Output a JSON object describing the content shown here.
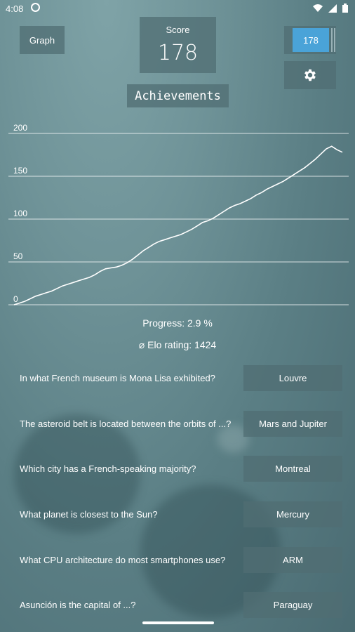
{
  "status": {
    "time": "4:08"
  },
  "header": {
    "graph_label": "Graph",
    "score_label": "Score",
    "score_value": "178",
    "elo_badge": "178",
    "achievements_label": "Achievements"
  },
  "chart_data": {
    "type": "line",
    "ylim": [
      0,
      200
    ],
    "yticks": [
      "200",
      "150",
      "100",
      "50",
      "0"
    ],
    "series": [
      {
        "values": [
          0,
          2,
          4,
          7,
          10,
          12,
          14,
          16,
          19,
          22,
          24,
          26,
          28,
          30,
          32,
          35,
          39,
          42,
          43,
          44,
          46,
          49,
          53,
          58,
          63,
          67,
          71,
          74,
          76,
          78,
          80,
          82,
          85,
          88,
          92,
          96,
          98,
          101,
          105,
          109,
          113,
          116,
          118,
          121,
          124,
          128,
          131,
          135,
          138,
          141,
          144,
          148,
          152,
          156,
          160,
          165,
          170,
          176,
          182,
          185,
          181,
          178
        ]
      }
    ]
  },
  "stats": {
    "progress": "Progress:  2.9 %",
    "elo": "⌀ Elo rating:  1424"
  },
  "qa": [
    {
      "q": "In what French museum is Mona Lisa exhibited?",
      "a": "Louvre"
    },
    {
      "q": "The asteroid belt is located between the orbits of ...?",
      "a": "Mars and Jupiter"
    },
    {
      "q": "Which city has a French-speaking majority?",
      "a": "Montreal"
    },
    {
      "q": "What planet is closest to the Sun?",
      "a": "Mercury"
    },
    {
      "q": "What CPU architecture do most smartphones use?",
      "a": "ARM"
    },
    {
      "q": "Asunción is the capital of ...?",
      "a": "Paraguay"
    }
  ]
}
